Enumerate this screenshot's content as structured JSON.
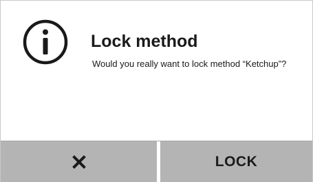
{
  "dialog": {
    "icon": "info-icon",
    "title": "Lock method",
    "message": "Would you really want to lock method “Ketchup”?"
  },
  "buttons": {
    "cancel_icon": "close-icon",
    "lock_label": "LOCK"
  },
  "colors": {
    "button_bar": "#b4b4b4",
    "text": "#1a1a1a",
    "divider": "#ffffff"
  }
}
